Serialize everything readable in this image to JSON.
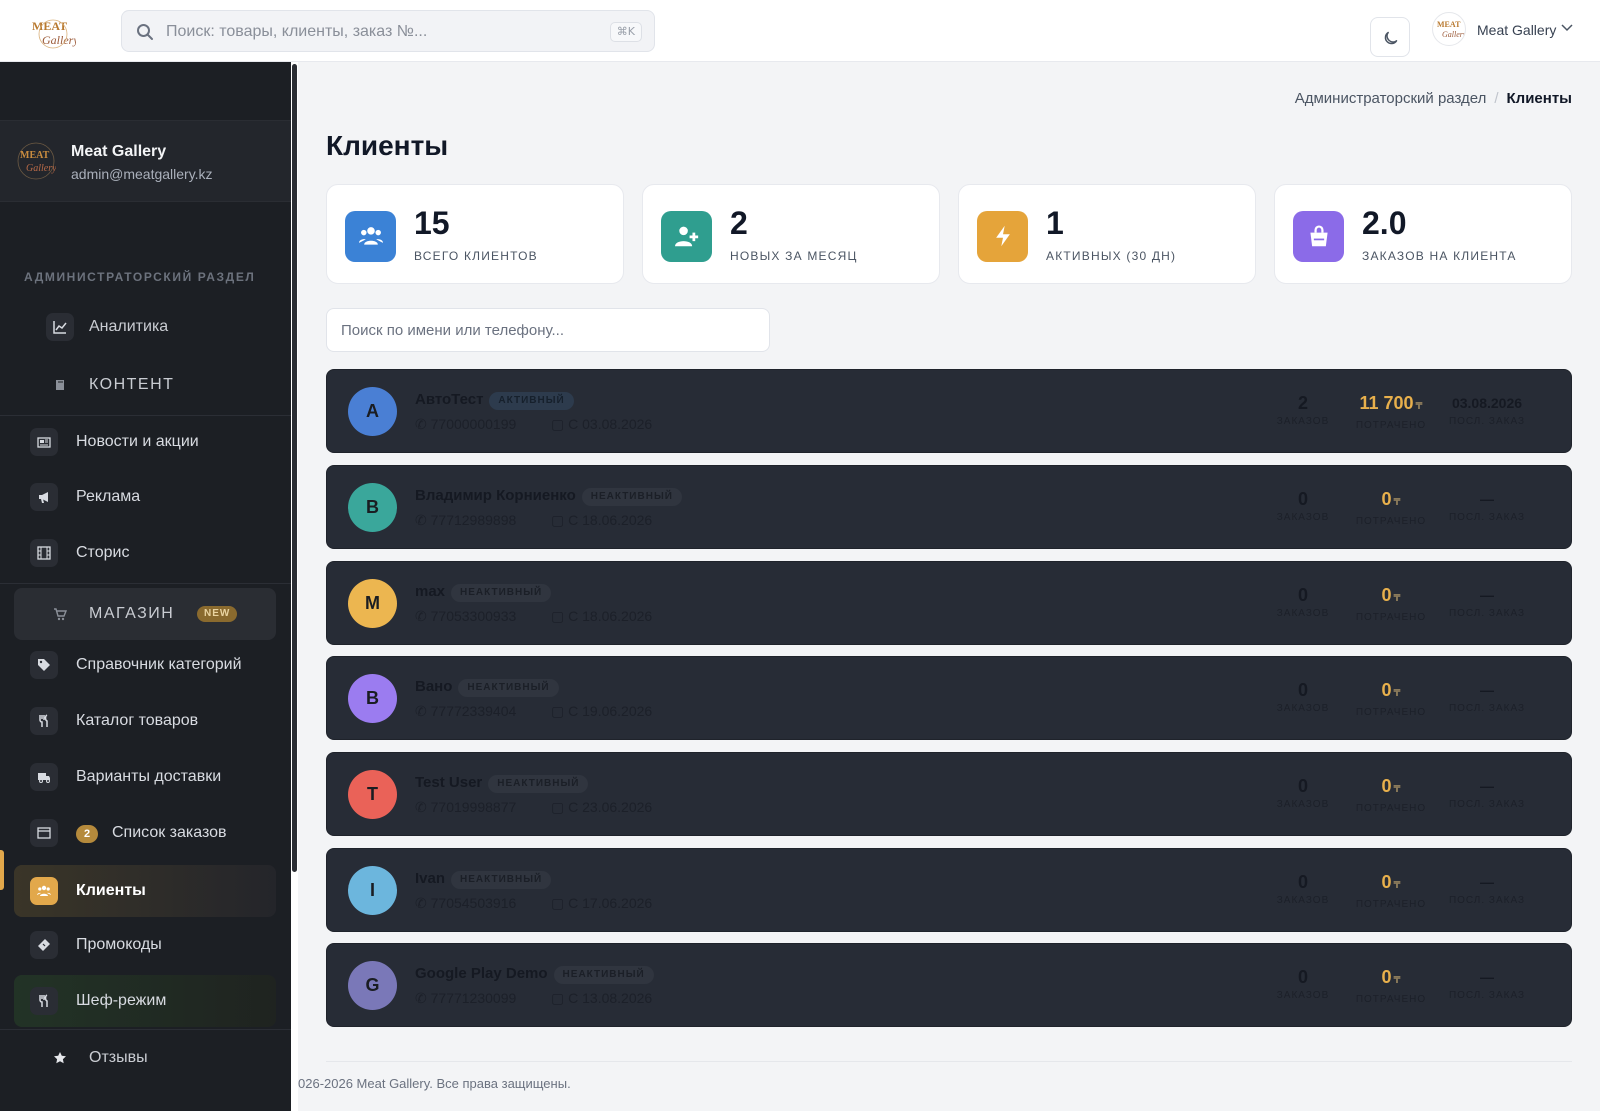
{
  "brand": {
    "logo": "Meat Gallery logo",
    "name": "Meat Gallery",
    "email": "admin@meatgallery.kz"
  },
  "topbar": {
    "search_placeholder": "Поиск: товары, клиенты, заказ №...",
    "shortcut": "⌘K",
    "user_name": "Meat Gallery"
  },
  "sidebar": {
    "section": "АДМИНИСТРАТОРСКИЙ РАЗДЕЛ",
    "items": [
      {
        "label": "Аналитика",
        "icon": "chart-line-icon"
      },
      {
        "label": "КОНТЕНТ",
        "icon": "book-icon"
      },
      {
        "label": "Новости и акции",
        "icon": "newspaper-icon"
      },
      {
        "label": "Реклама",
        "icon": "megaphone-icon"
      },
      {
        "label": "Сторис",
        "icon": "film-icon"
      },
      {
        "label": "МАГАЗИН",
        "icon": "cart-icon",
        "badge": "NEW"
      },
      {
        "label": "Справочник категорий",
        "icon": "tags-icon"
      },
      {
        "label": "Каталог товаров",
        "icon": "utensils-icon"
      },
      {
        "label": "Варианты доставки",
        "icon": "truck-icon"
      },
      {
        "label": "Список заказов",
        "icon": "list-icon",
        "badge": "2"
      },
      {
        "label": "Клиенты",
        "icon": "users-icon"
      },
      {
        "label": "Промокоды",
        "icon": "ticket-icon"
      },
      {
        "label": "Шеф-режим",
        "icon": "utensils-icon"
      },
      {
        "label": "Отзывы",
        "icon": "star-icon"
      }
    ]
  },
  "breadcrumb": {
    "parent": "Администраторский раздел",
    "separator": "/",
    "current": "Клиенты"
  },
  "page": {
    "title": "Клиенты",
    "client_search_placeholder": "Поиск по имени или телефону..."
  },
  "stats": [
    {
      "value": "15",
      "label": "ВСЕГО КЛИЕНТОВ",
      "color": "#3b82d6",
      "icon": "users-icon"
    },
    {
      "value": "2",
      "label": "НОВЫХ ЗА МЕСЯЦ",
      "color": "#2f9e8f",
      "icon": "user-plus-icon"
    },
    {
      "value": "1",
      "label": "АКТИВНЫХ (30 ДН)",
      "color": "#e5a43a",
      "icon": "bolt-icon"
    },
    {
      "value": "2.0",
      "label": "ЗАКАЗОВ НА КЛИЕНТА",
      "color": "#8b6be8",
      "icon": "bag-icon"
    }
  ],
  "labels": {
    "orders": "ЗАКАЗОВ",
    "spent": "ПОТРАЧЕНО",
    "last_order": "ПОСЛ. ЗАКАЗ",
    "currency": "₸"
  },
  "clients": [
    {
      "initial": "A",
      "color": "#4a7fd4",
      "name": "АвтоТест",
      "status": "АКТИВНЫЙ",
      "phone": "77000000199",
      "since": "С 03.08.2026",
      "orders": "2",
      "spent": "11 700",
      "last": "03.08.2026"
    },
    {
      "initial": "B",
      "color": "#3aa79b",
      "name": "Владимир Корниенко",
      "status": "НЕАКТИВНЫЙ",
      "phone": "77712989898",
      "since": "С 18.06.2026",
      "orders": "0",
      "spent": "0",
      "last": "—"
    },
    {
      "initial": "M",
      "color": "#ecb650",
      "name": "max",
      "status": "НЕАКТИВНЫЙ",
      "phone": "77053300933",
      "since": "С 18.06.2026",
      "orders": "0",
      "spent": "0",
      "last": "—"
    },
    {
      "initial": "B",
      "color": "#9b7cf0",
      "name": "Вано",
      "status": "НЕАКТИВНЫЙ",
      "phone": "77772339404",
      "since": "С 19.06.2026",
      "orders": "0",
      "spent": "0",
      "last": "—"
    },
    {
      "initial": "T",
      "color": "#ea6258",
      "name": "Test User",
      "status": "НЕАКТИВНЫЙ",
      "phone": "77019998877",
      "since": "С 23.06.2026",
      "orders": "0",
      "spent": "0",
      "last": "—"
    },
    {
      "initial": "I",
      "color": "#6cb6dd",
      "name": "Ivan",
      "status": "НЕАКТИВНЫЙ",
      "phone": "77054503916",
      "since": "С 17.06.2026",
      "orders": "0",
      "spent": "0",
      "last": "—"
    },
    {
      "initial": "G",
      "color": "#7a78b8",
      "name": "Google Play Demo",
      "status": "НЕАКТИВНЫЙ",
      "phone": "77771230099",
      "since": "С 13.08.2026",
      "orders": "0",
      "spent": "0",
      "last": "—"
    }
  ],
  "footer": "026-2026 Meat Gallery. Все права защищены."
}
